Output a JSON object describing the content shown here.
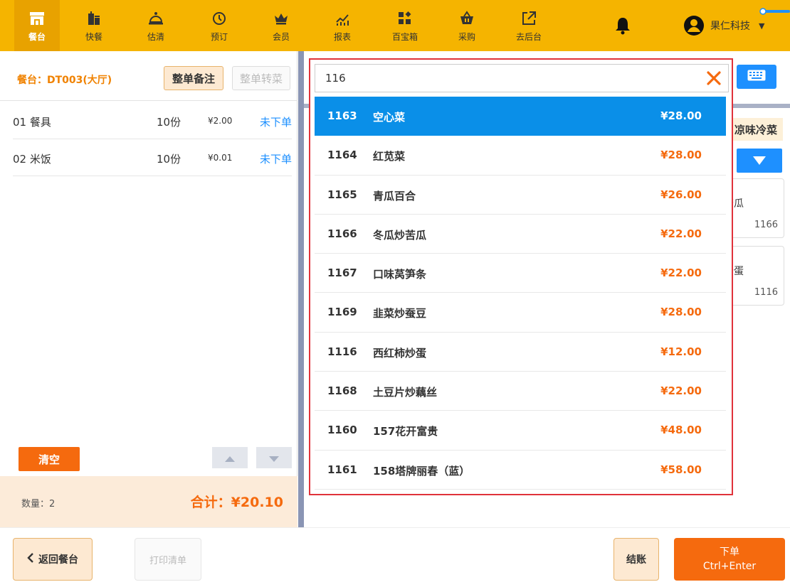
{
  "nav": {
    "items": [
      {
        "label": "餐台",
        "icon": "store-icon",
        "active": true
      },
      {
        "label": "快餐",
        "icon": "fastfood-icon"
      },
      {
        "label": "估清",
        "icon": "cloche-icon"
      },
      {
        "label": "预订",
        "icon": "clock-icon"
      },
      {
        "label": "会员",
        "icon": "crown-icon"
      },
      {
        "label": "报表",
        "icon": "chart-icon"
      },
      {
        "label": "百宝箱",
        "icon": "toolbox-icon"
      },
      {
        "label": "采购",
        "icon": "basket-icon"
      },
      {
        "label": "去后台",
        "icon": "external-link-icon"
      }
    ],
    "user_name": "果仁科技",
    "accent": "#f5b400"
  },
  "order": {
    "table_label": "餐台：DT003(大厅)",
    "note_button": "整单备注",
    "transfer_button": "整单转菜",
    "items": [
      {
        "name": "01 餐具",
        "qty": "10份",
        "price": "¥2.00",
        "status": "未下单"
      },
      {
        "name": "02 米饭",
        "qty": "10份",
        "price": "¥0.01",
        "status": "未下单"
      }
    ],
    "clear_button": "清空",
    "quantity": "数量：2",
    "total": "合计：¥20.10"
  },
  "menu_bg": {
    "category": "凉味冷菜",
    "cards": [
      {
        "name": "苦瓜",
        "code": "1166"
      },
      {
        "name": "炒蛋",
        "code": "1116"
      }
    ]
  },
  "search": {
    "query": "116",
    "results": [
      {
        "code": "1163",
        "name": "空心菜",
        "price": "¥28.00",
        "selected": true
      },
      {
        "code": "1164",
        "name": "红苋菜",
        "price": "¥28.00"
      },
      {
        "code": "1165",
        "name": "青瓜百合",
        "price": "¥26.00"
      },
      {
        "code": "1166",
        "name": "冬瓜炒苦瓜",
        "price": "¥22.00"
      },
      {
        "code": "1167",
        "name": "口味莴笋条",
        "price": "¥22.00"
      },
      {
        "code": "1169",
        "name": "韭菜炒蚕豆",
        "price": "¥28.00"
      },
      {
        "code": "1116",
        "name": "西红柿炒蛋",
        "price": "¥12.00"
      },
      {
        "code": "1168",
        "name": "土豆片炒藕丝",
        "price": "¥22.00"
      },
      {
        "code": "1160",
        "name": "157花开富贵",
        "price": "¥48.00"
      },
      {
        "code": "1161",
        "name": "158塔牌丽春（蓝）",
        "price": "¥58.00"
      }
    ]
  },
  "bottom": {
    "back_button": "返回餐台",
    "print_button": "打印清单",
    "checkout_button": "结账",
    "submit_button": "下单",
    "submit_shortcut": "Ctrl+Enter"
  }
}
